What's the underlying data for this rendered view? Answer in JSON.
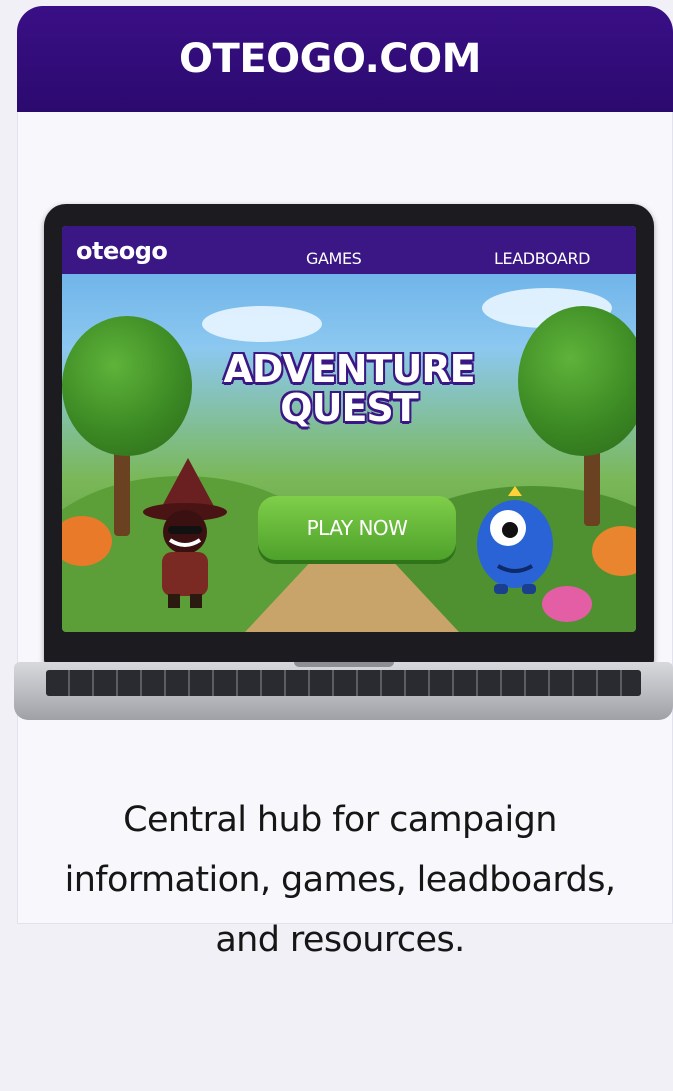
{
  "header": {
    "title": "OTEOGO.COM"
  },
  "laptop_screen": {
    "logo": "oteogo",
    "nav_items": [
      "GAMES",
      "LEADBOARD"
    ],
    "game_title_line1": "ADVENTURE",
    "game_title_line2": "QUEST",
    "play_button_label": "PLAY NOW"
  },
  "tagline": "Central hub for campaign information, games, leadboards, and resources.",
  "colors": {
    "header_bg": "#2b0a6e",
    "screen_nav_bg": "#3a1784",
    "play_button": "#4ea12a",
    "page_bg": "#f1f0f7"
  }
}
